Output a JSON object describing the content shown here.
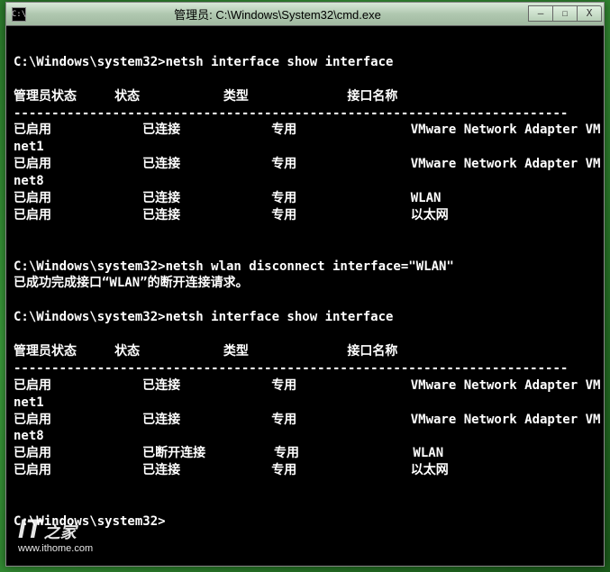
{
  "window": {
    "title": "管理员: C:\\Windows\\System32\\cmd.exe",
    "icon_label": "C:\\",
    "controls": {
      "minimize": "—",
      "maximize": "☐",
      "close": "X"
    }
  },
  "terminal": {
    "lines": [
      "",
      "C:\\Windows\\system32>netsh interface show interface",
      "",
      "管理员状态     状态           类型             接口名称",
      "-------------------------------------------------------------------------",
      "已启用            已连接            专用               VMware Network Adapter VM",
      "net1",
      "已启用            已连接            专用               VMware Network Adapter VM",
      "net8",
      "已启用            已连接            专用               WLAN",
      "已启用            已连接            专用               以太网",
      "",
      "",
      "C:\\Windows\\system32>netsh wlan disconnect interface=\"WLAN\"",
      "已成功完成接口“WLAN”的断开连接请求。",
      "",
      "C:\\Windows\\system32>netsh interface show interface",
      "",
      "管理员状态     状态           类型             接口名称",
      "-------------------------------------------------------------------------",
      "已启用            已连接            专用               VMware Network Adapter VM",
      "net1",
      "已启用            已连接            专用               VMware Network Adapter VM",
      "net8",
      "已启用            已断开连接         专用               WLAN",
      "已启用            已连接            专用               以太网",
      "",
      "",
      "C:\\Windows\\system32>"
    ]
  },
  "watermark": {
    "logo_it": "IT",
    "logo_zhija": "之家",
    "url": "www.ithome.com"
  }
}
